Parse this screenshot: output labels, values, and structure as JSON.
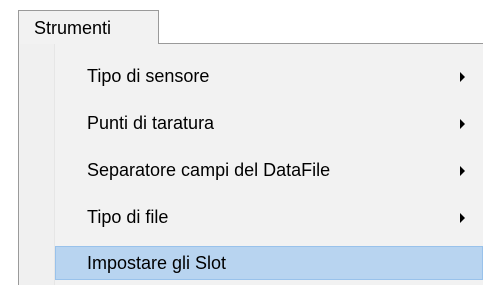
{
  "menubar": {
    "title": "Strumenti"
  },
  "dropdown": {
    "items": [
      {
        "label": "Tipo di sensore",
        "submenu": true,
        "highlighted": false
      },
      {
        "label": "Punti di taratura",
        "submenu": true,
        "highlighted": false
      },
      {
        "label": "Separatore campi del DataFile",
        "submenu": true,
        "highlighted": false
      },
      {
        "label": "Tipo di file",
        "submenu": true,
        "highlighted": false
      },
      {
        "label": "Impostare gli Slot",
        "submenu": false,
        "highlighted": true
      }
    ]
  },
  "colors": {
    "menu_background": "#f2f2f2",
    "highlight_background": "#b8d4f0",
    "highlight_border": "#99c2eb",
    "border": "#9a9a9a"
  },
  "icons": {
    "submenu_arrow": "chevron-right-icon"
  }
}
